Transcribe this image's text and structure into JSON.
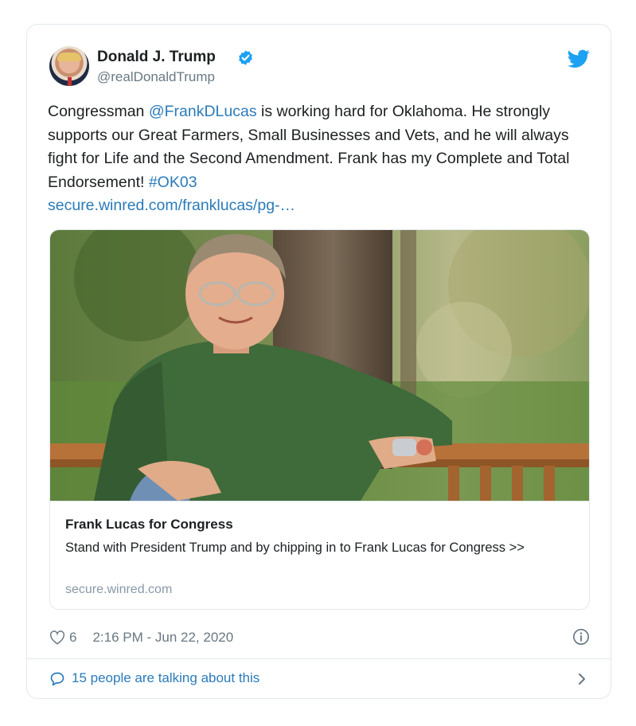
{
  "tweet": {
    "author_name": "Donald J. Trump",
    "handle": "@realDonaldTrump",
    "text": {
      "p1": "Congressman ",
      "mention": "@FrankDLucas",
      "p2": " is working hard for Oklahoma. He strongly supports our Great Farmers, Small Businesses and Vets, and he will always fight for Life and the Second Amendment. Frank has my Complete and Total Endorsement! ",
      "hashtag": "#OK03",
      "url": "secure.winred.com/franklucas/pg-…"
    },
    "likes": "6",
    "timestamp": "2:16 PM - Jun 22, 2020"
  },
  "link_card": {
    "title": "Frank Lucas for Congress",
    "description": "Stand with President Trump and by chipping in to Frank Lucas for Congress >>",
    "domain": "secure.winred.com"
  },
  "footer": {
    "conversation_text": "15 people are talking about this"
  },
  "icons": {
    "verified": "verified-badge-icon",
    "twitter": "twitter-bird-icon",
    "like": "heart-icon",
    "info": "info-icon",
    "reply": "speech-bubble-icon",
    "chevron": "chevron-right-icon"
  },
  "colors": {
    "link": "#2b7bb9",
    "twitter_blue": "#1da1f2",
    "muted": "#697882",
    "border": "#e1e8ed"
  }
}
